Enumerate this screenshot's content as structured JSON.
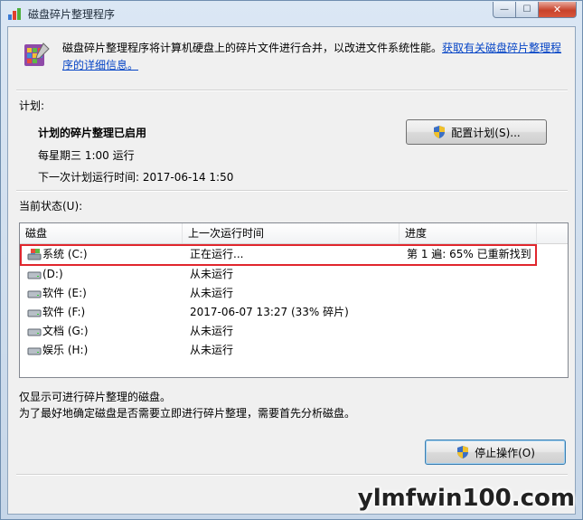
{
  "window": {
    "title": "磁盘碎片整理程序",
    "caption": {
      "minimize": "—",
      "maximize": "☐",
      "close": "✕"
    }
  },
  "header": {
    "description": "磁盘碎片整理程序将计算机硬盘上的碎片文件进行合并，以改进文件系统性能。",
    "link": "获取有关磁盘碎片整理程序的详细信息。"
  },
  "schedule": {
    "section_label": "计划:",
    "status": "计划的碎片整理已启用",
    "frequency": "每星期三  1:00 运行",
    "next_run": "下一次计划运行时间: 2017-06-14 1:50",
    "configure_button": "配置计划(S)..."
  },
  "current_status": {
    "section_label": "当前状态(U):",
    "columns": [
      "磁盘",
      "上一次运行时间",
      "进度"
    ],
    "rows": [
      {
        "disk": "系统 (C:)",
        "last_run": "正在运行...",
        "progress": "第 1 遍: 65% 已重新找到",
        "icon": "system-drive-icon"
      },
      {
        "disk": "(D:)",
        "last_run": "从未运行",
        "progress": "",
        "icon": "drive-icon"
      },
      {
        "disk": "软件 (E:)",
        "last_run": "从未运行",
        "progress": "",
        "icon": "drive-icon"
      },
      {
        "disk": "软件 (F:)",
        "last_run": "2017-06-07 13:27 (33% 碎片)",
        "progress": "",
        "icon": "drive-icon"
      },
      {
        "disk": "文档 (G:)",
        "last_run": "从未运行",
        "progress": "",
        "icon": "drive-icon"
      },
      {
        "disk": "娱乐 (H:)",
        "last_run": "从未运行",
        "progress": "",
        "icon": "drive-icon"
      }
    ]
  },
  "footer": {
    "note1": "仅显示可进行碎片整理的磁盘。",
    "note2": "为了最好地确定磁盘是否需要立即进行碎片整理，需要首先分析磁盘。",
    "stop_button": "停止操作(O)"
  },
  "watermark": "ylmfwin100.com",
  "colors": {
    "highlight": "#e0262d",
    "link": "#0645c6"
  }
}
